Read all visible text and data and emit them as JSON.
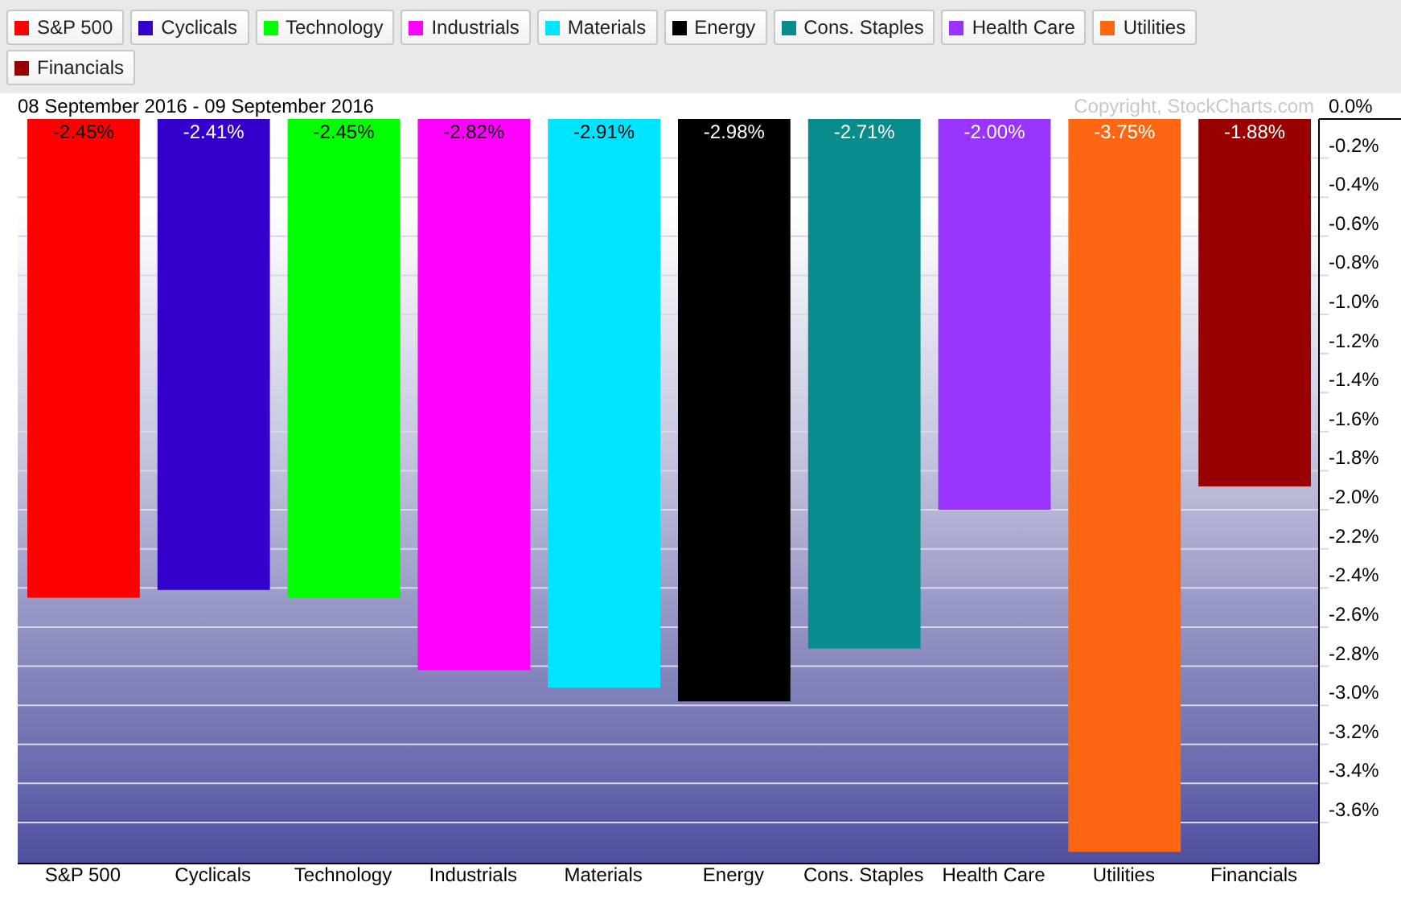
{
  "legend": [
    {
      "label": "S&P 500",
      "color": "#ff0000"
    },
    {
      "label": "Cyclicals",
      "color": "#3300cc"
    },
    {
      "label": "Technology",
      "color": "#00ff00"
    },
    {
      "label": "Industrials",
      "color": "#ff00ff"
    },
    {
      "label": "Materials",
      "color": "#00e5ff"
    },
    {
      "label": "Energy",
      "color": "#000000"
    },
    {
      "label": "Cons. Staples",
      "color": "#088c8c"
    },
    {
      "label": "Health Care",
      "color": "#9933ff"
    },
    {
      "label": "Utilities",
      "color": "#ff6611"
    },
    {
      "label": "Financials",
      "color": "#990000"
    }
  ],
  "date_range": "08 September 2016 - 09 September 2016",
  "copyright": "Copyright, StockCharts.com",
  "chart_data": {
    "type": "bar",
    "categories": [
      "S&P 500",
      "Cyclicals",
      "Technology",
      "Industrials",
      "Materials",
      "Energy",
      "Cons. Staples",
      "Health Care",
      "Utilities",
      "Financials"
    ],
    "values": [
      -2.45,
      -2.41,
      -2.45,
      -2.82,
      -2.91,
      -2.98,
      -2.71,
      -2.0,
      -3.75,
      -1.88
    ],
    "grid": true,
    "colors": [
      "#ff0000",
      "#3300cc",
      "#00ff00",
      "#ff00ff",
      "#00e5ff",
      "#000000",
      "#088c8c",
      "#9933ff",
      "#ff6611",
      "#990000"
    ],
    "value_labels": [
      "-2.45%",
      "-2.41%",
      "-2.45%",
      "-2.82%",
      "-2.91%",
      "-2.98%",
      "-2.71%",
      "-2.00%",
      "-3.75%",
      "-1.88%"
    ],
    "ylim": [
      -3.81,
      0
    ],
    "yticks": [
      {
        "value": 0,
        "label": "0.0%"
      },
      {
        "value": -0.2,
        "label": "-0.2%"
      },
      {
        "value": -0.4,
        "label": "-0.4%"
      },
      {
        "value": -0.6,
        "label": "-0.6%"
      },
      {
        "value": -0.8,
        "label": "-0.8%"
      },
      {
        "value": -1.0,
        "label": "-1.0%"
      },
      {
        "value": -1.2,
        "label": "-1.2%"
      },
      {
        "value": -1.4,
        "label": "-1.4%"
      },
      {
        "value": -1.6,
        "label": "-1.6%"
      },
      {
        "value": -1.8,
        "label": "-1.8%"
      },
      {
        "value": -2.0,
        "label": "-2.0%"
      },
      {
        "value": -2.2,
        "label": "-2.2%"
      },
      {
        "value": -2.4,
        "label": "-2.4%"
      },
      {
        "value": -2.6,
        "label": "-2.6%"
      },
      {
        "value": -2.8,
        "label": "-2.8%"
      },
      {
        "value": -3.0,
        "label": "-3.0%"
      },
      {
        "value": -3.2,
        "label": "-3.2%"
      },
      {
        "value": -3.4,
        "label": "-3.4%"
      },
      {
        "value": -3.6,
        "label": "-3.6%"
      }
    ]
  }
}
